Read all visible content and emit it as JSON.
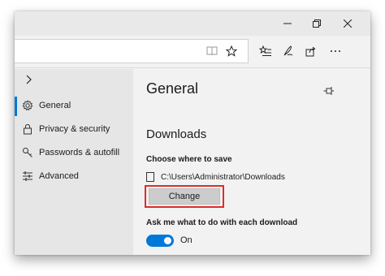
{
  "icons": {
    "minimize": "minimize-icon",
    "maximize": "restore-icon",
    "close": "close-icon",
    "reading_view": "book-icon",
    "favorite": "star-icon",
    "favorites_hub": "favorites-list-icon",
    "notes": "pen-icon",
    "share": "share-icon",
    "pin": "pin-icon"
  },
  "sidebar": {
    "items": [
      {
        "label": "General",
        "icon": "gear-icon",
        "active": true
      },
      {
        "label": "Privacy & security",
        "icon": "lock-icon",
        "active": false
      },
      {
        "label": "Passwords & autofill",
        "icon": "key-icon",
        "active": false
      },
      {
        "label": "Advanced",
        "icon": "sliders-icon",
        "active": false
      }
    ]
  },
  "main": {
    "title": "General",
    "downloads": {
      "section_title": "Downloads",
      "choose_label": "Choose where to save",
      "path": "C:\\Users\\Administrator\\Downloads",
      "change_button": "Change",
      "ask_label": "Ask me what to do with each download",
      "toggle_state": "On",
      "toggle_on": true
    }
  },
  "colors": {
    "accent": "#0078d7",
    "highlight_border": "#e02b2b",
    "sidebar_bg": "#e6e6e6",
    "pane_bg": "#f2f2f2"
  }
}
